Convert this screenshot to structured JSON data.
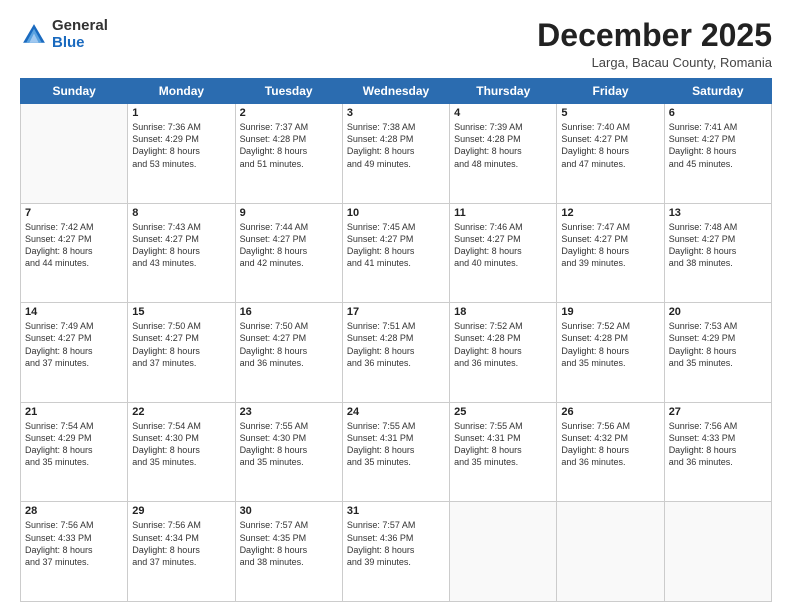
{
  "header": {
    "logo_general": "General",
    "logo_blue": "Blue",
    "month_title": "December 2025",
    "subtitle": "Larga, Bacau County, Romania"
  },
  "weekdays": [
    "Sunday",
    "Monday",
    "Tuesday",
    "Wednesday",
    "Thursday",
    "Friday",
    "Saturday"
  ],
  "weeks": [
    [
      {
        "day": "",
        "info": ""
      },
      {
        "day": "1",
        "info": "Sunrise: 7:36 AM\nSunset: 4:29 PM\nDaylight: 8 hours\nand 53 minutes."
      },
      {
        "day": "2",
        "info": "Sunrise: 7:37 AM\nSunset: 4:28 PM\nDaylight: 8 hours\nand 51 minutes."
      },
      {
        "day": "3",
        "info": "Sunrise: 7:38 AM\nSunset: 4:28 PM\nDaylight: 8 hours\nand 49 minutes."
      },
      {
        "day": "4",
        "info": "Sunrise: 7:39 AM\nSunset: 4:28 PM\nDaylight: 8 hours\nand 48 minutes."
      },
      {
        "day": "5",
        "info": "Sunrise: 7:40 AM\nSunset: 4:27 PM\nDaylight: 8 hours\nand 47 minutes."
      },
      {
        "day": "6",
        "info": "Sunrise: 7:41 AM\nSunset: 4:27 PM\nDaylight: 8 hours\nand 45 minutes."
      }
    ],
    [
      {
        "day": "7",
        "info": "Sunrise: 7:42 AM\nSunset: 4:27 PM\nDaylight: 8 hours\nand 44 minutes."
      },
      {
        "day": "8",
        "info": "Sunrise: 7:43 AM\nSunset: 4:27 PM\nDaylight: 8 hours\nand 43 minutes."
      },
      {
        "day": "9",
        "info": "Sunrise: 7:44 AM\nSunset: 4:27 PM\nDaylight: 8 hours\nand 42 minutes."
      },
      {
        "day": "10",
        "info": "Sunrise: 7:45 AM\nSunset: 4:27 PM\nDaylight: 8 hours\nand 41 minutes."
      },
      {
        "day": "11",
        "info": "Sunrise: 7:46 AM\nSunset: 4:27 PM\nDaylight: 8 hours\nand 40 minutes."
      },
      {
        "day": "12",
        "info": "Sunrise: 7:47 AM\nSunset: 4:27 PM\nDaylight: 8 hours\nand 39 minutes."
      },
      {
        "day": "13",
        "info": "Sunrise: 7:48 AM\nSunset: 4:27 PM\nDaylight: 8 hours\nand 38 minutes."
      }
    ],
    [
      {
        "day": "14",
        "info": "Sunrise: 7:49 AM\nSunset: 4:27 PM\nDaylight: 8 hours\nand 37 minutes."
      },
      {
        "day": "15",
        "info": "Sunrise: 7:50 AM\nSunset: 4:27 PM\nDaylight: 8 hours\nand 37 minutes."
      },
      {
        "day": "16",
        "info": "Sunrise: 7:50 AM\nSunset: 4:27 PM\nDaylight: 8 hours\nand 36 minutes."
      },
      {
        "day": "17",
        "info": "Sunrise: 7:51 AM\nSunset: 4:28 PM\nDaylight: 8 hours\nand 36 minutes."
      },
      {
        "day": "18",
        "info": "Sunrise: 7:52 AM\nSunset: 4:28 PM\nDaylight: 8 hours\nand 36 minutes."
      },
      {
        "day": "19",
        "info": "Sunrise: 7:52 AM\nSunset: 4:28 PM\nDaylight: 8 hours\nand 35 minutes."
      },
      {
        "day": "20",
        "info": "Sunrise: 7:53 AM\nSunset: 4:29 PM\nDaylight: 8 hours\nand 35 minutes."
      }
    ],
    [
      {
        "day": "21",
        "info": "Sunrise: 7:54 AM\nSunset: 4:29 PM\nDaylight: 8 hours\nand 35 minutes."
      },
      {
        "day": "22",
        "info": "Sunrise: 7:54 AM\nSunset: 4:30 PM\nDaylight: 8 hours\nand 35 minutes."
      },
      {
        "day": "23",
        "info": "Sunrise: 7:55 AM\nSunset: 4:30 PM\nDaylight: 8 hours\nand 35 minutes."
      },
      {
        "day": "24",
        "info": "Sunrise: 7:55 AM\nSunset: 4:31 PM\nDaylight: 8 hours\nand 35 minutes."
      },
      {
        "day": "25",
        "info": "Sunrise: 7:55 AM\nSunset: 4:31 PM\nDaylight: 8 hours\nand 35 minutes."
      },
      {
        "day": "26",
        "info": "Sunrise: 7:56 AM\nSunset: 4:32 PM\nDaylight: 8 hours\nand 36 minutes."
      },
      {
        "day": "27",
        "info": "Sunrise: 7:56 AM\nSunset: 4:33 PM\nDaylight: 8 hours\nand 36 minutes."
      }
    ],
    [
      {
        "day": "28",
        "info": "Sunrise: 7:56 AM\nSunset: 4:33 PM\nDaylight: 8 hours\nand 37 minutes."
      },
      {
        "day": "29",
        "info": "Sunrise: 7:56 AM\nSunset: 4:34 PM\nDaylight: 8 hours\nand 37 minutes."
      },
      {
        "day": "30",
        "info": "Sunrise: 7:57 AM\nSunset: 4:35 PM\nDaylight: 8 hours\nand 38 minutes."
      },
      {
        "day": "31",
        "info": "Sunrise: 7:57 AM\nSunset: 4:36 PM\nDaylight: 8 hours\nand 39 minutes."
      },
      {
        "day": "",
        "info": ""
      },
      {
        "day": "",
        "info": ""
      },
      {
        "day": "",
        "info": ""
      }
    ]
  ]
}
